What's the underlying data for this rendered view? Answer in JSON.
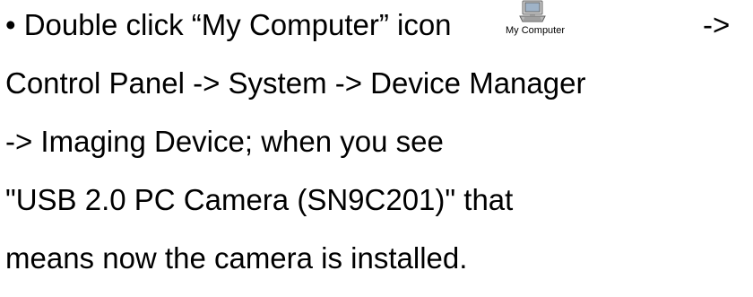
{
  "instructions": {
    "line1_text": "• Double click “My Computer” icon",
    "icon": {
      "name": "my-computer-icon",
      "label": "My Computer"
    },
    "line1_suffix": "->",
    "line2": "Control Panel -> System -> Device Manager",
    "line3": "-> Imaging Device; when you see",
    "line4": "\"USB 2.0 PC Camera (SN9C201)\" that",
    "line5": "means now the camera is installed."
  }
}
